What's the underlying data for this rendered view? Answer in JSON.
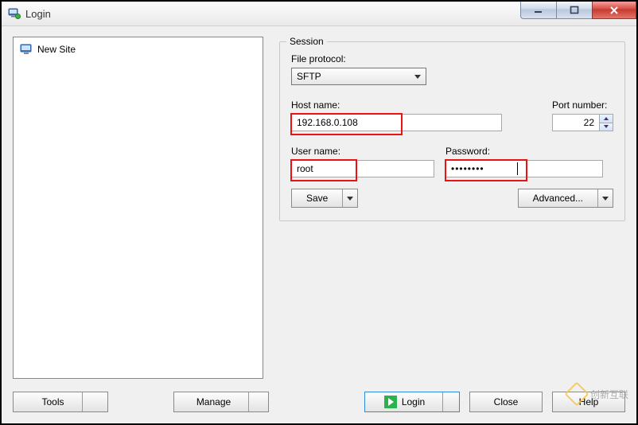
{
  "window": {
    "title": "Login"
  },
  "tree": {
    "items": [
      {
        "label": "New Site"
      }
    ]
  },
  "session": {
    "legend": "Session",
    "protocol_label": "File protocol:",
    "protocol_value": "SFTP",
    "host_label": "Host name:",
    "host_value": "192.168.0.108",
    "port_label": "Port number:",
    "port_value": "22",
    "user_label": "User name:",
    "user_value": "root",
    "pass_label": "Password:",
    "pass_value": "••••••••",
    "save_label": "Save",
    "advanced_label": "Advanced..."
  },
  "footer": {
    "tools_label": "Tools",
    "manage_label": "Manage",
    "login_label": "Login",
    "close_label": "Close",
    "help_label": "Help"
  },
  "watermark": "创新互联"
}
